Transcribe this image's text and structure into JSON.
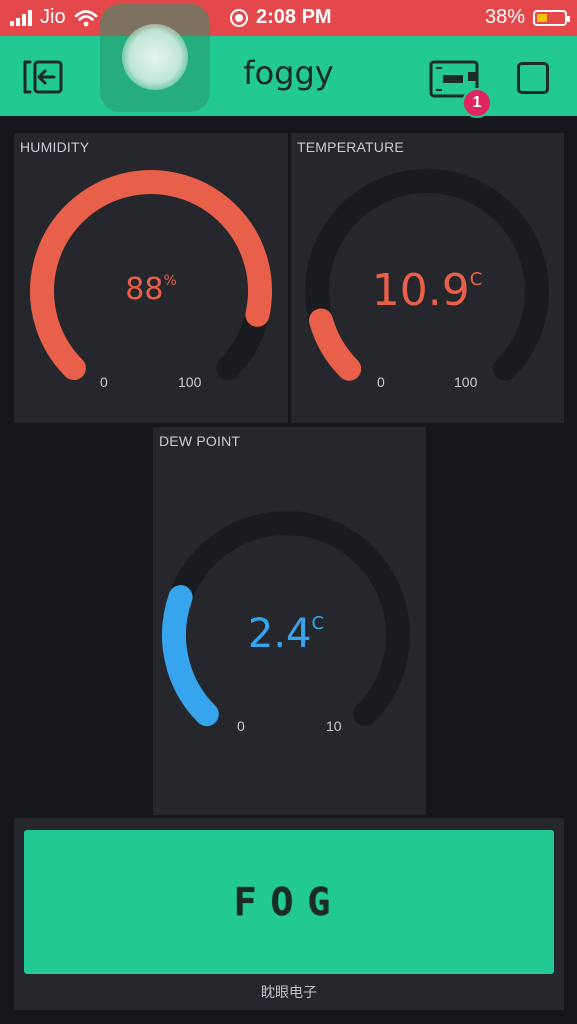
{
  "status_bar": {
    "carrier": "Jio",
    "time": "2:08 PM",
    "battery_percent": "38%",
    "battery_level": 0.38,
    "bg_color": "#e5484b"
  },
  "header": {
    "title": "foggy",
    "badge_count": "1",
    "bg_color": "#23c993",
    "icons": [
      "exit-icon",
      "device-icon",
      "stop-icon"
    ]
  },
  "gauges": {
    "humidity": {
      "title": "HUMIDITY",
      "value": 88,
      "value_text": "88",
      "unit": "%",
      "min": "0",
      "max": "100",
      "color": "#e8604a"
    },
    "temperature": {
      "title": "TEMPERATURE",
      "value": 10.9,
      "value_text": "10.9",
      "unit": "C",
      "min": "0",
      "max": "100",
      "color": "#e8604a"
    },
    "dew_point": {
      "title": "DEW POINT",
      "value": 2.4,
      "value_text": "2.4",
      "unit": "C",
      "min": "0",
      "max": "10",
      "color": "#37a5ee"
    }
  },
  "display": {
    "text": "FOG",
    "caption": "眈眼电子",
    "bg_color": "#23c993"
  }
}
